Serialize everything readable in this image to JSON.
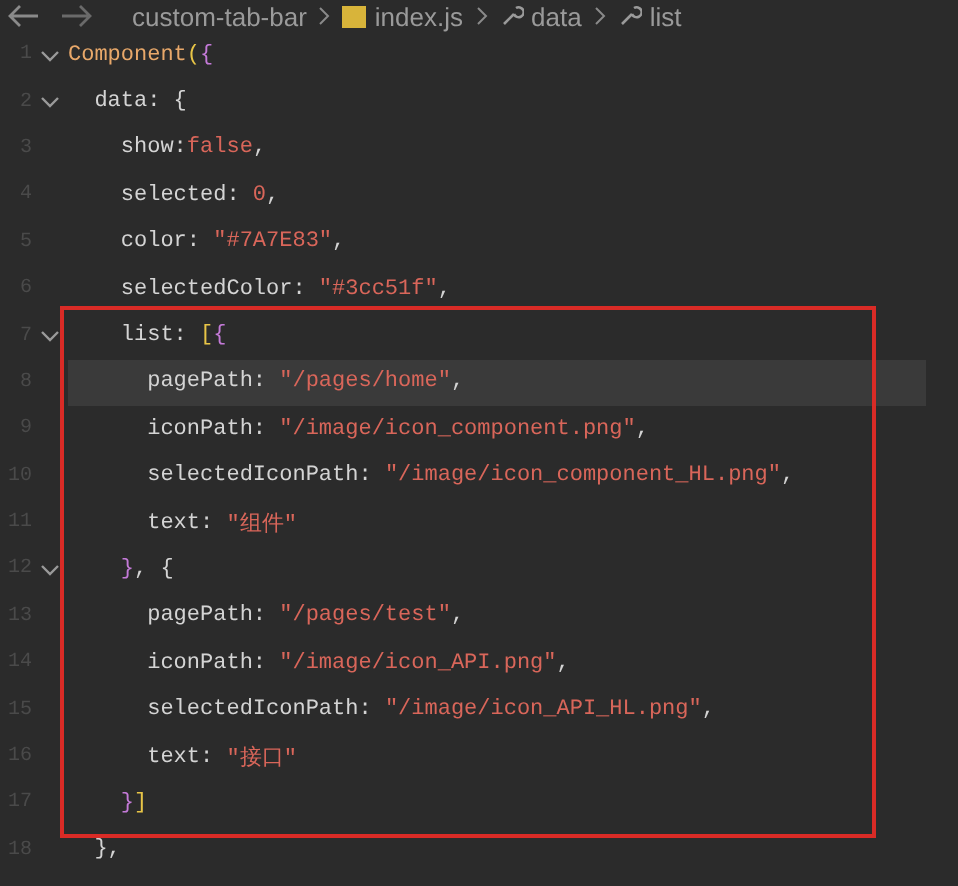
{
  "breadcrumb": [
    {
      "kind": "folder",
      "text": "custom-tab-bar"
    },
    {
      "kind": "js",
      "text": "index.js"
    },
    {
      "kind": "property",
      "text": "data"
    },
    {
      "kind": "property",
      "text": "list"
    }
  ],
  "editor": {
    "lines_above": [
      {
        "number": "1",
        "expanded": true,
        "current": false,
        "tokens": [
          {
            "kind": "func",
            "text": "Component"
          },
          {
            "kind": "paren",
            "text": "("
          },
          {
            "kind": "brace",
            "text": "{"
          }
        ]
      },
      {
        "number": "2",
        "expanded": true,
        "current": false,
        "tokens": [
          {
            "kind": "plain",
            "text": "  data: {"
          }
        ]
      },
      {
        "number": "3",
        "current": false,
        "tokens": [
          {
            "kind": "plain",
            "text": "    show:"
          },
          {
            "kind": "keyword",
            "text": "false"
          },
          {
            "kind": "plain",
            "text": ","
          }
        ]
      },
      {
        "number": "4",
        "current": false,
        "tokens": [
          {
            "kind": "plain",
            "text": "    selected: "
          },
          {
            "kind": "number",
            "text": "0"
          },
          {
            "kind": "plain",
            "text": ","
          }
        ]
      },
      {
        "number": "5",
        "current": false,
        "tokens": [
          {
            "kind": "plain",
            "text": "    color: "
          },
          {
            "kind": "string",
            "text": "\"#7A7E83\""
          },
          {
            "kind": "plain",
            "text": ","
          }
        ]
      },
      {
        "number": "6",
        "current": false,
        "tokens": [
          {
            "kind": "plain",
            "text": "    selectedColor: "
          },
          {
            "kind": "string",
            "text": "\"#3cc51f\""
          },
          {
            "kind": "plain",
            "text": ","
          }
        ]
      }
    ],
    "annotated_block": [
      {
        "number": "7",
        "expanded": true,
        "current": false,
        "tokens": [
          {
            "kind": "plain",
            "text": "    list: "
          },
          {
            "kind": "paren",
            "text": "["
          },
          {
            "kind": "brace",
            "text": "{"
          }
        ]
      },
      {
        "number": "8",
        "current": true,
        "tokens": [
          {
            "kind": "plain",
            "text": "      pagePath: "
          },
          {
            "kind": "string",
            "text": "\"/pages/home\""
          },
          {
            "kind": "plain",
            "text": ","
          }
        ]
      },
      {
        "number": "9",
        "current": false,
        "tokens": [
          {
            "kind": "plain",
            "text": "      iconPath: "
          },
          {
            "kind": "string",
            "text": "\"/image/icon_component.png\""
          },
          {
            "kind": "plain",
            "text": ","
          }
        ]
      },
      {
        "number": "10",
        "current": false,
        "tokens": [
          {
            "kind": "plain",
            "text": "      selectedIconPath: "
          },
          {
            "kind": "string",
            "text": "\"/image/icon_component_HL.png\""
          },
          {
            "kind": "plain",
            "text": ","
          }
        ]
      },
      {
        "number": "11",
        "current": false,
        "tokens": [
          {
            "kind": "plain",
            "text": "      text: "
          },
          {
            "kind": "string",
            "text": "\"组件\""
          }
        ]
      },
      {
        "number": "12",
        "expanded": true,
        "current": false,
        "tokens": [
          {
            "kind": "brace",
            "text": "    }"
          },
          {
            "kind": "plain",
            "text": ", {"
          }
        ]
      },
      {
        "number": "13",
        "current": false,
        "tokens": [
          {
            "kind": "plain",
            "text": "      pagePath: "
          },
          {
            "kind": "string",
            "text": "\"/pages/test\""
          },
          {
            "kind": "plain",
            "text": ","
          }
        ]
      },
      {
        "number": "14",
        "current": false,
        "tokens": [
          {
            "kind": "plain",
            "text": "      iconPath: "
          },
          {
            "kind": "string",
            "text": "\"/image/icon_API.png\""
          },
          {
            "kind": "plain",
            "text": ","
          }
        ]
      },
      {
        "number": "15",
        "current": false,
        "tokens": [
          {
            "kind": "plain",
            "text": "      selectedIconPath: "
          },
          {
            "kind": "string",
            "text": "\"/image/icon_API_HL.png\""
          },
          {
            "kind": "plain",
            "text": ","
          }
        ]
      },
      {
        "number": "16",
        "current": false,
        "tokens": [
          {
            "kind": "plain",
            "text": "      text: "
          },
          {
            "kind": "string",
            "text": "\"接口\""
          }
        ]
      },
      {
        "number": "17",
        "current": false,
        "tokens": [
          {
            "kind": "brace",
            "text": "    }"
          },
          {
            "kind": "paren",
            "text": "]"
          }
        ]
      }
    ],
    "lines_below": [
      {
        "number": "18",
        "current": false,
        "tokens": [
          {
            "kind": "plain",
            "text": "  },"
          }
        ]
      }
    ]
  }
}
